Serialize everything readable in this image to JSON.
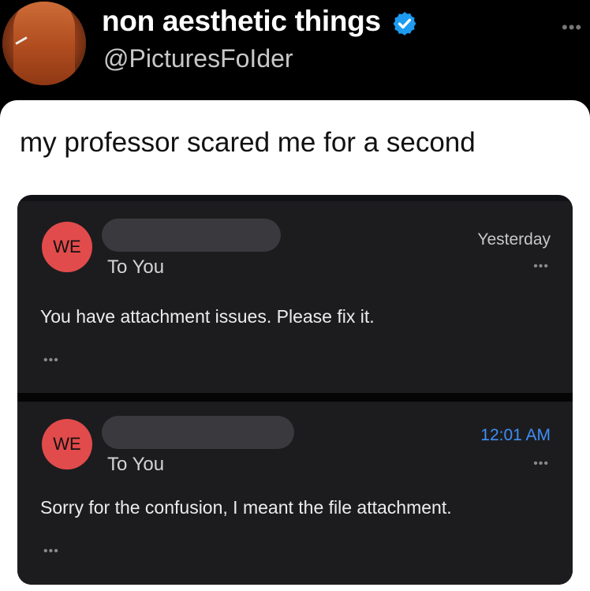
{
  "post": {
    "display_name": "non aesthetic things",
    "handle": "@PicturesFoIder",
    "more_icon": "more-horizontal-icon",
    "verified_color": "#1d9bf0",
    "caption": "my professor scared me for a second"
  },
  "emails": [
    {
      "badge": "WE",
      "recipient": "To You",
      "time": "Yesterday",
      "body": "You have attachment issues. Please fix it."
    },
    {
      "badge": "WE",
      "recipient": "To You",
      "time": "12:01 AM",
      "time_color": "#3e8ff7",
      "body": "Sorry for the confusion, I meant the file attachment."
    }
  ],
  "colors": {
    "badge_bg": "#e24b4b",
    "card_bg": "#ffffff",
    "page_bg": "#000000"
  }
}
